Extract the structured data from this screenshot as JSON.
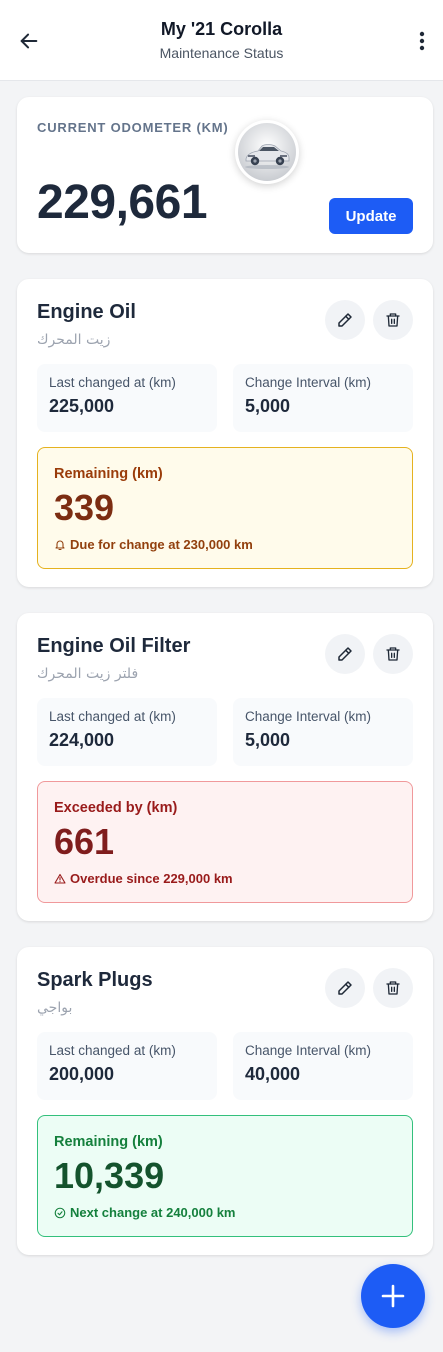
{
  "header": {
    "title": "My '21 Corolla",
    "subtitle": "Maintenance Status",
    "back_icon": "arrow-left-icon",
    "menu_icon": "more-vertical-icon"
  },
  "odometer": {
    "label": "CURRENT ODOMETER (KM)",
    "value": "229,661",
    "update_label": "Update",
    "image": "car-photo"
  },
  "items": [
    {
      "title": "Engine Oil",
      "subtitle_ar": "زيت المحرك",
      "last_changed_label": "Last changed at (km)",
      "last_changed_value": "225,000",
      "interval_label": "Change Interval (km)",
      "interval_value": "5,000",
      "status": {
        "type": "warning",
        "label": "Remaining (km)",
        "value": "339",
        "note": "Due for change at 230,000 km",
        "icon": "bell-icon"
      }
    },
    {
      "title": "Engine Oil Filter",
      "subtitle_ar": "فلتر زيت المحرك",
      "last_changed_label": "Last changed at (km)",
      "last_changed_value": "224,000",
      "interval_label": "Change Interval (km)",
      "interval_value": "5,000",
      "status": {
        "type": "danger",
        "label": "Exceeded by (km)",
        "value": "661",
        "note": "Overdue since 229,000 km",
        "icon": "alert-triangle-icon"
      }
    },
    {
      "title": "Spark Plugs",
      "subtitle_ar": "بواجي",
      "last_changed_label": "Last changed at (km)",
      "last_changed_value": "200,000",
      "interval_label": "Change Interval (km)",
      "interval_value": "40,000",
      "status": {
        "type": "ok",
        "label": "Remaining (km)",
        "value": "10,339",
        "note": "Next change at 240,000 km",
        "icon": "check-circle-icon"
      }
    }
  ],
  "fab": {
    "icon": "plus-icon"
  },
  "colors": {
    "primary": "#1d5cf5",
    "warning_bg": "#fffbeb",
    "danger_bg": "#fef2f2",
    "ok_bg": "#ecfdf5"
  }
}
